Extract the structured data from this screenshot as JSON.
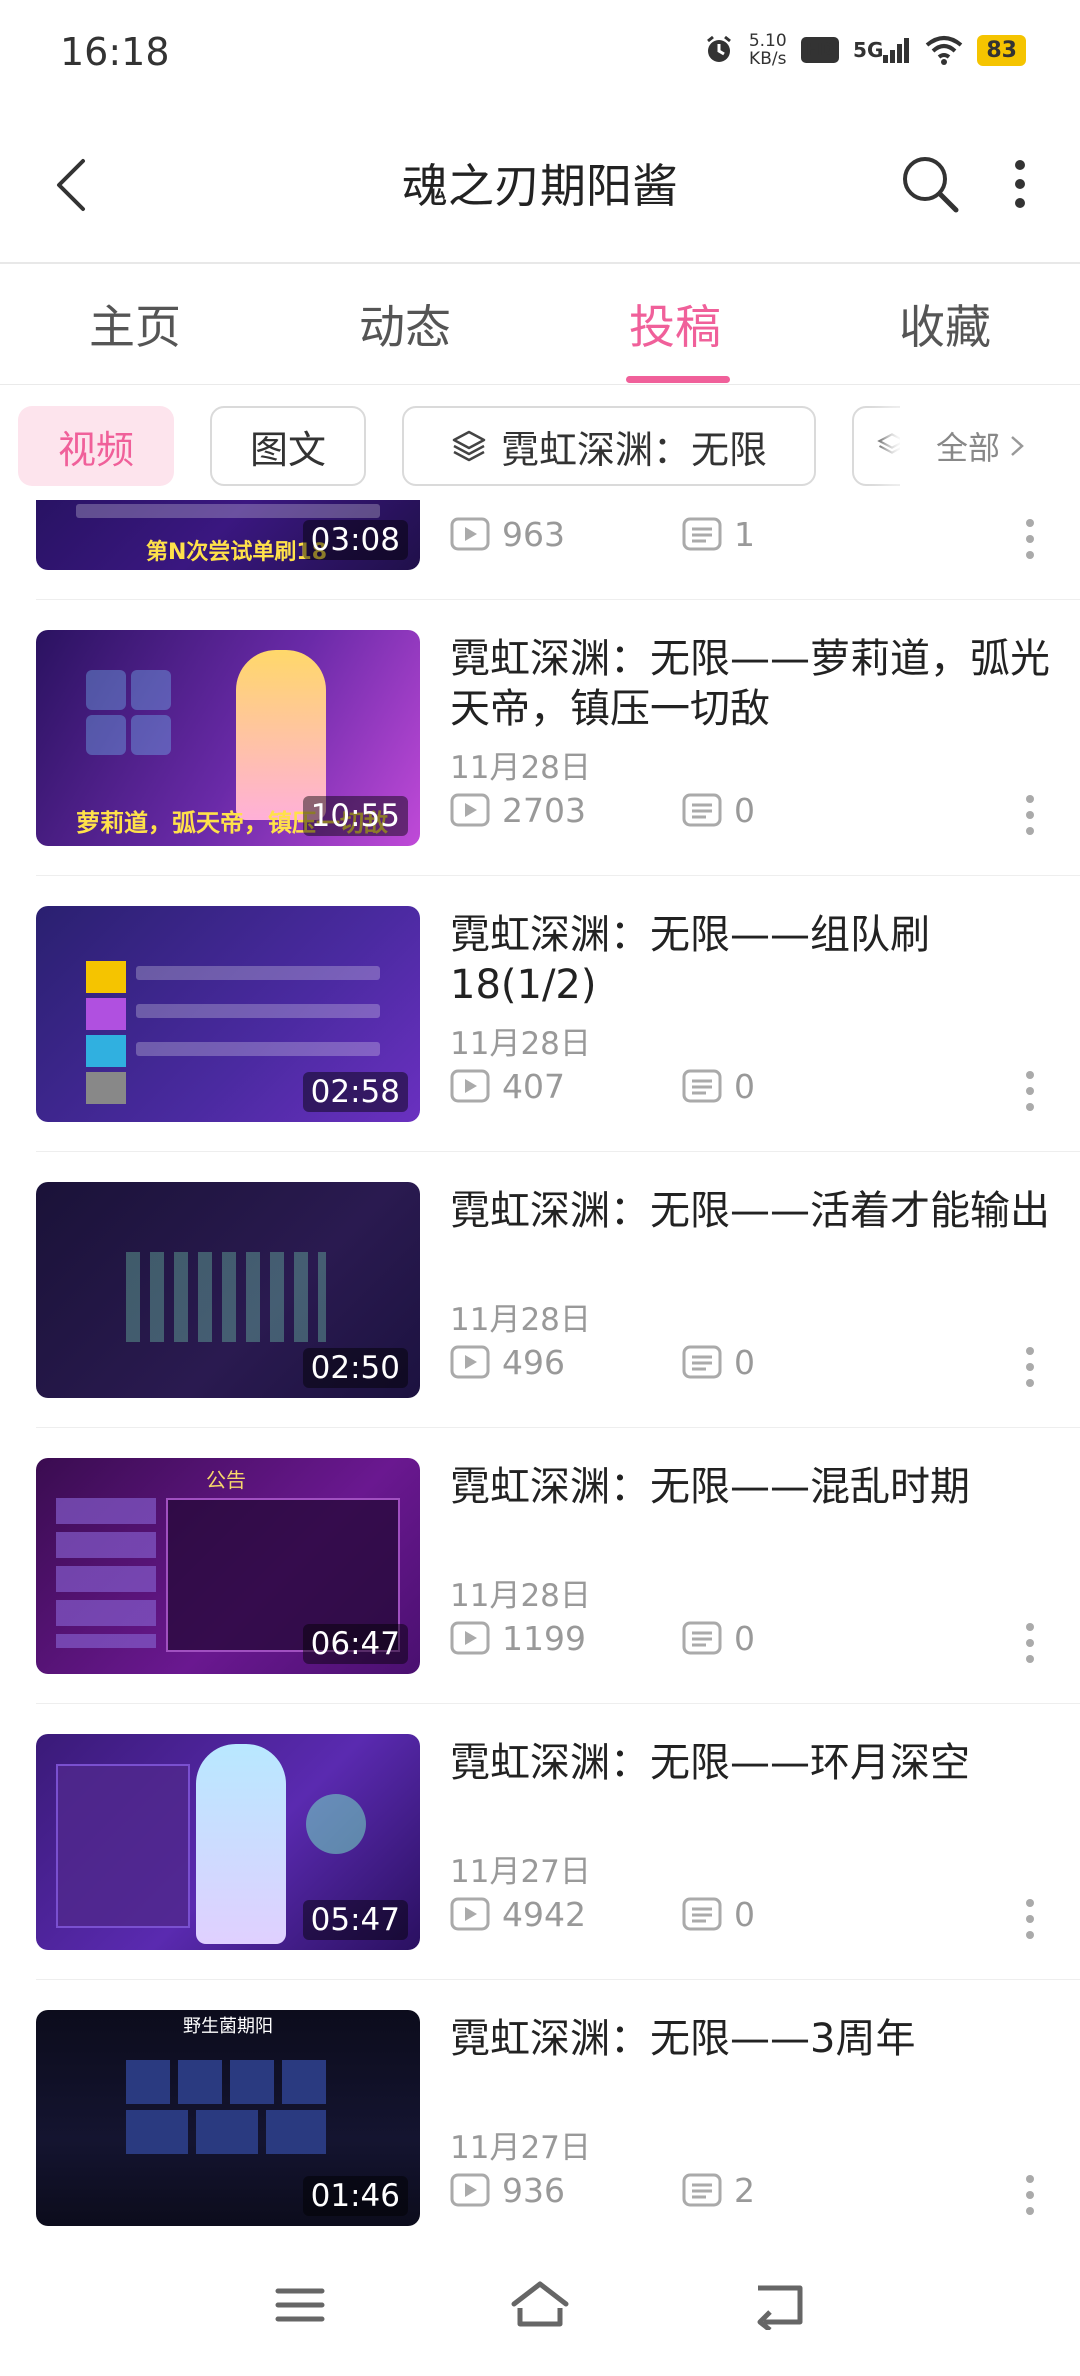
{
  "status_bar": {
    "time": "16:18",
    "net_speed_value": "5.10",
    "net_speed_unit": "KB/s",
    "hd": "HD",
    "signal": "5G",
    "battery": "83",
    "icons": [
      "alarm-icon",
      "hd-icon",
      "signal-icon",
      "wifi-icon",
      "battery-icon"
    ]
  },
  "header": {
    "title": "魂之刃期阳酱",
    "icons": [
      "back-arrow-icon",
      "search-icon",
      "more-vertical-icon"
    ]
  },
  "tabs": [
    {
      "label": "主页",
      "active": false
    },
    {
      "label": "动态",
      "active": false
    },
    {
      "label": "投稿",
      "active": true
    },
    {
      "label": "收藏",
      "active": false
    }
  ],
  "filters": {
    "chips": [
      {
        "label": "视频",
        "active": true
      },
      {
        "label": "图文",
        "active": false
      },
      {
        "label": "霓虹深渊：无限",
        "icon": "layers-icon",
        "active": false
      }
    ],
    "all_label": "全部",
    "colors": {
      "accent": "#f0609a",
      "chip_active_bg": "#fde4ed"
    }
  },
  "videos": [
    {
      "title": "",
      "date": "",
      "views": "963",
      "comments": "1",
      "duration": "03:08",
      "thumb_caption": "第N次尝试单刷18",
      "partial": true
    },
    {
      "title": "霓虹深渊：无限——萝莉道，弧光天帝，镇压一切敌",
      "date": "11月28日",
      "views": "2703",
      "comments": "0",
      "duration": "10:55",
      "thumb_caption": "萝莉道，弧天帝，镇压一切敌"
    },
    {
      "title": "霓虹深渊：无限——组队刷18(1/2)",
      "date": "11月28日",
      "views": "407",
      "comments": "0",
      "duration": "02:58",
      "thumb_caption": ""
    },
    {
      "title": "霓虹深渊：无限——活着才能输出",
      "date": "11月28日",
      "views": "496",
      "comments": "0",
      "duration": "02:50",
      "thumb_caption": ""
    },
    {
      "title": "霓虹深渊：无限——混乱时期",
      "date": "11月28日",
      "views": "1199",
      "comments": "0",
      "duration": "06:47",
      "thumb_caption": "公告"
    },
    {
      "title": "霓虹深渊：无限——环月深空",
      "date": "11月27日",
      "views": "4942",
      "comments": "0",
      "duration": "05:47",
      "thumb_caption": ""
    },
    {
      "title": "霓虹深渊：无限——3周年",
      "date": "11月27日",
      "views": "936",
      "comments": "2",
      "duration": "01:46",
      "thumb_caption": "野生菌期阳"
    }
  ],
  "nav_bar": {
    "icons": [
      "menu-icon",
      "home-icon",
      "back-icon"
    ]
  }
}
